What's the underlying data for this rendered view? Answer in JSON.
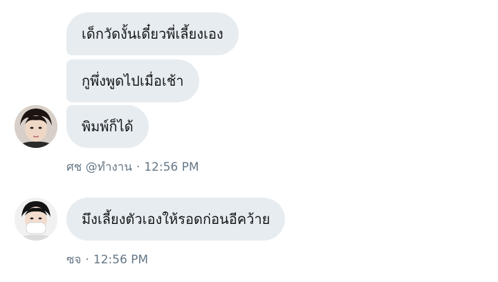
{
  "conversation": {
    "group1": {
      "messages": [
        "เด็กวัดงั้นเดี๋ยวพี่เลี้ยงเอง",
        "กูพึ่งพูดไปเมื่อเช้า",
        "พิมพ์ก็ได้"
      ],
      "sender": "ศช @ทำงาน",
      "time": "12:56 PM",
      "separator": "·"
    },
    "group2": {
      "messages": [
        "มึงเลี้ยงตัวเองให้รอดก่อนอีคว้าย"
      ],
      "sender": "ซจ",
      "time": "12:56 PM",
      "separator": "·"
    }
  },
  "colors": {
    "bubble": "#e6ecf0",
    "text": "#14171a",
    "meta": "#657786"
  },
  "icons": [
    "avatar-photo-1",
    "avatar-photo-2"
  ]
}
